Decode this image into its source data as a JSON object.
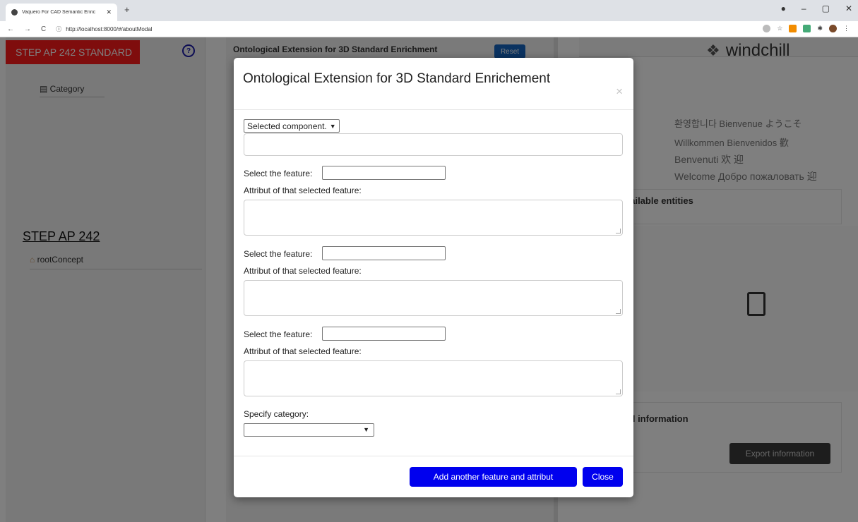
{
  "browser": {
    "tab_title": "Vaquero For CAD Semantic Enric",
    "tab_close": "✕",
    "new_tab": "+",
    "url": "http://localhost:8000/#/aboutModal",
    "window_controls": {
      "minimize": "–",
      "maximize": "▢",
      "close": "✕"
    }
  },
  "left_panel": {
    "header": "STEP AP 242 STANDARD",
    "help": "?",
    "category": "Category",
    "step_link": "STEP AP 242",
    "root_concept": "rootConcept"
  },
  "middle_panel": {
    "title": "Ontological Extension for 3D Standard Enrichment",
    "reset": "Reset"
  },
  "right_panel": {
    "logo_text": "windchill",
    "greetings": [
      "환영합니다  Bienvenue  ようこそ",
      "Willkommen  Bienvenidos  歡",
      "Benvenuti     欢 迎",
      "Welcome  Добро пожаловать  迎"
    ],
    "available_entities": "vailable entities",
    "detail_information": "ail information",
    "export_button": "Export information"
  },
  "modal": {
    "title": "Ontological Extension for 3D Standard Enrichement",
    "close_icon": "×",
    "component_select": "Selected component.",
    "feature_blocks": [
      {
        "feature_label": "Select the feature:",
        "attribute_label": "Attribut of that selected feature:"
      },
      {
        "feature_label": "Select the feature:",
        "attribute_label": "Attribut of that selected feature:"
      },
      {
        "feature_label": "Select the feature:",
        "attribute_label": "Attribut of that selected feature:"
      }
    ],
    "category_label": "Specify category:",
    "add_button": "Add another feature and attribut",
    "close_button": "Close"
  }
}
